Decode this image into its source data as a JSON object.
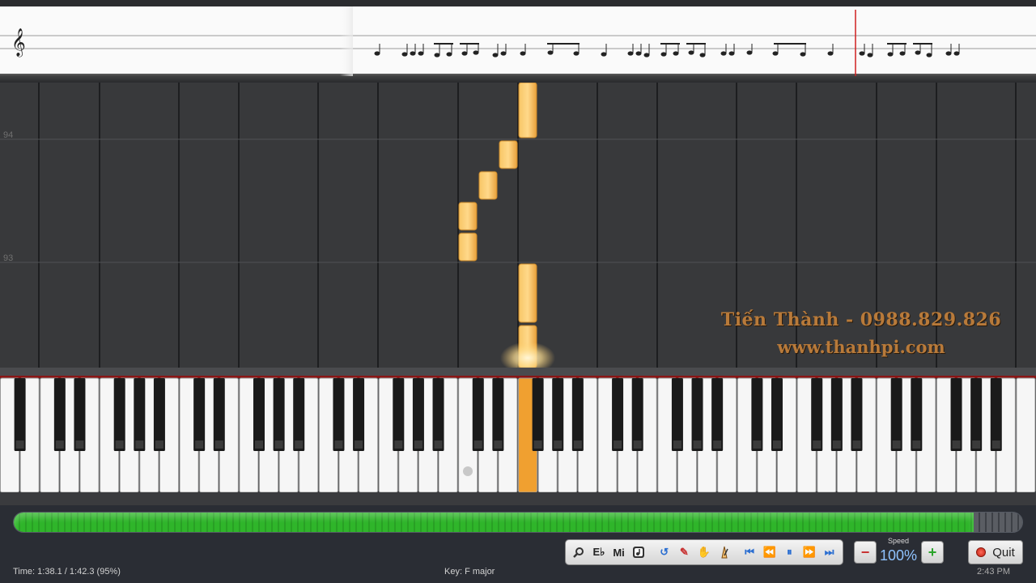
{
  "sheet": {
    "clef": "treble-clef"
  },
  "roll": {
    "marker_94": "94",
    "marker_93": "93"
  },
  "watermark": {
    "line1": "Tiến Thành - 0988.829.826",
    "line2": "www.thanhpi.com"
  },
  "progress": {
    "fraction": 0.95
  },
  "toolbar": {
    "zoom_icon": "magnifier-icon",
    "key_label": "E♭",
    "note_label": "Mi",
    "sheet_icon": "sheet-music-icon",
    "loop_icon": "undo-icon",
    "pencil_icon": "pencil-icon",
    "hand_icon": "hand-icon",
    "metronome_icon": "metronome-icon",
    "first_icon": "skip-to-start-icon",
    "rewind_icon": "rewind-icon",
    "pause_icon": "pause-icon",
    "forward_icon": "fast-forward-icon",
    "last_icon": "skip-to-end-icon"
  },
  "speed": {
    "label": "Speed",
    "value": "100%",
    "minus": "−",
    "plus": "+"
  },
  "quit": {
    "label": "Quit"
  },
  "status": {
    "time": "Time:   1:38.1 / 1:42.3 (95%)",
    "key": "Key: F major",
    "clock": "2:43 PM"
  },
  "colors": {
    "note": "#f5b54a",
    "progress": "#2fb52a",
    "active_key": "#f0a030"
  }
}
